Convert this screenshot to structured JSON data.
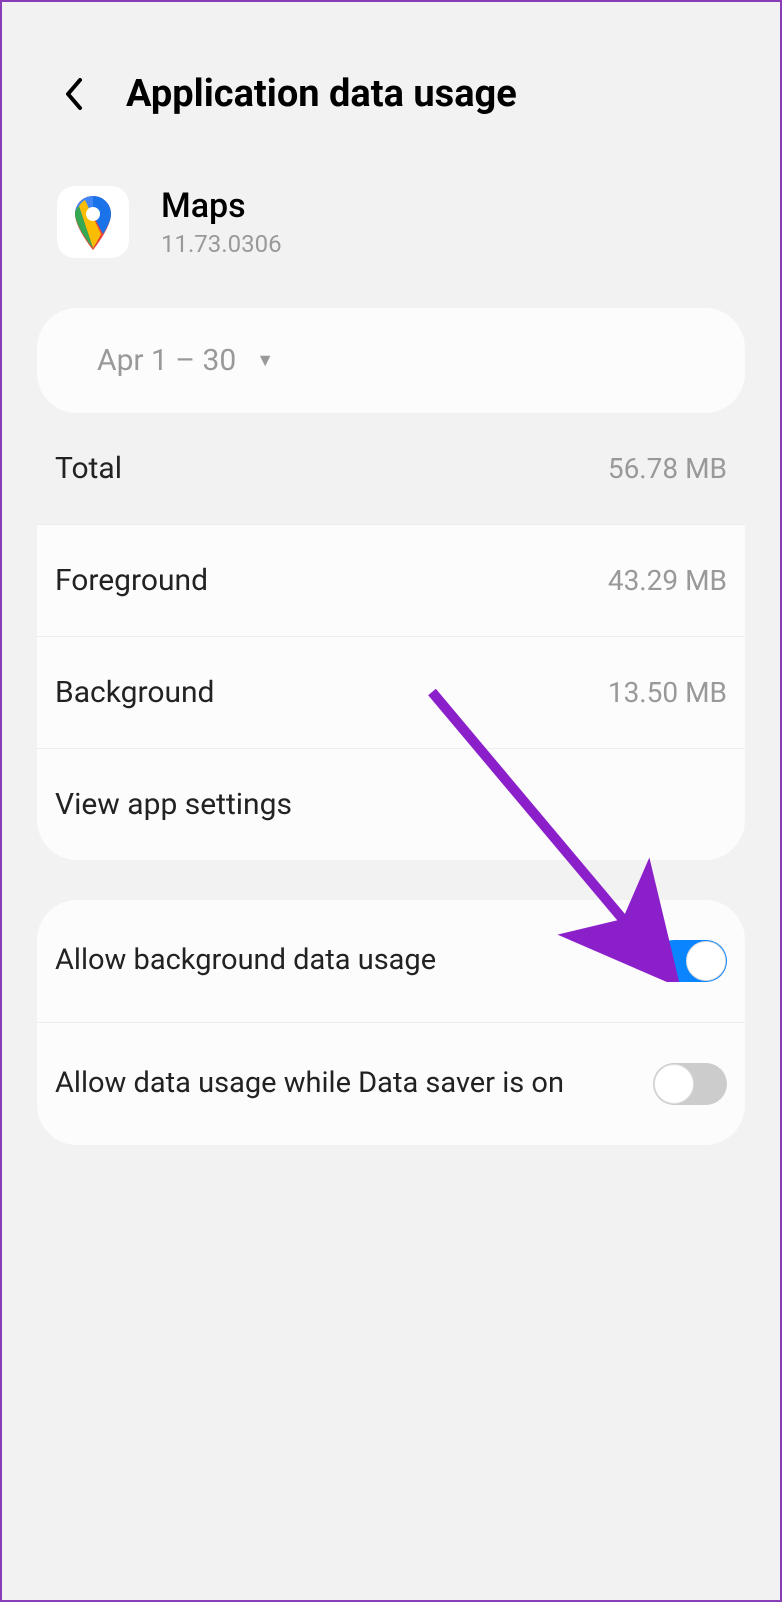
{
  "header": {
    "title": "Application data usage"
  },
  "app": {
    "name": "Maps",
    "version": "11.73.0306"
  },
  "period": {
    "label": "Apr 1 – 30"
  },
  "stats": {
    "total": {
      "label": "Total",
      "value": "56.78 MB"
    },
    "foreground": {
      "label": "Foreground",
      "value": "43.29 MB"
    },
    "background": {
      "label": "Background",
      "value": "13.50 MB"
    }
  },
  "links": {
    "view_app_settings": "View app settings"
  },
  "toggles": {
    "allow_background": {
      "label": "Allow background data usage",
      "state": "on"
    },
    "allow_data_saver": {
      "label": "Allow data usage while Data saver is on",
      "state": "off"
    }
  }
}
